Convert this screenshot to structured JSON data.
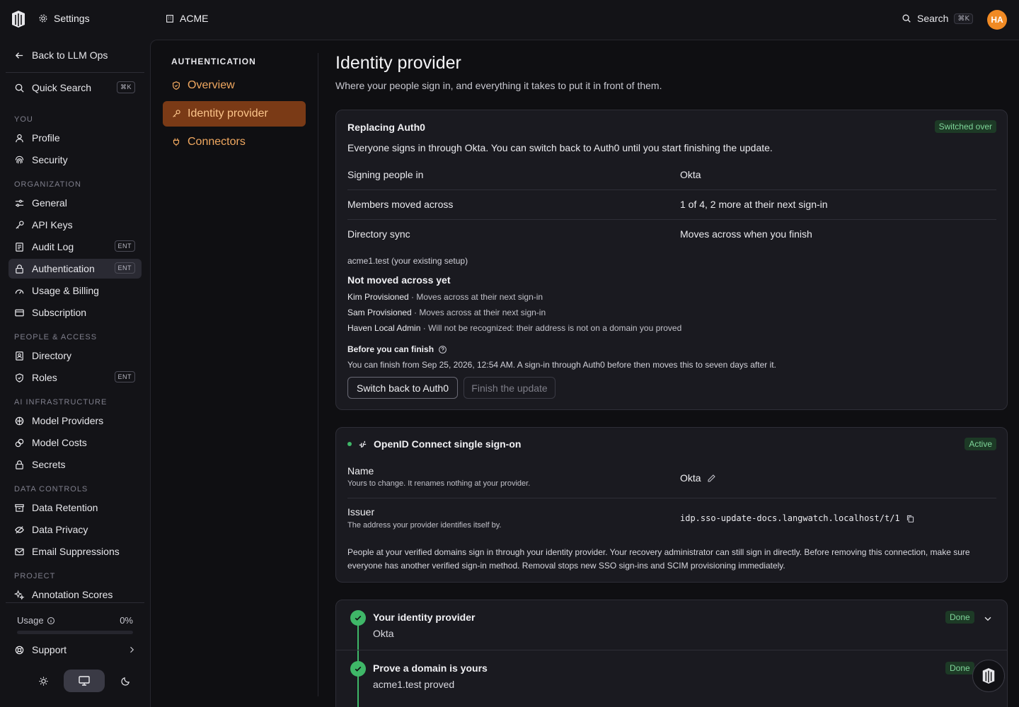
{
  "topbar": {
    "settings_label": "Settings",
    "org_label": "ACME",
    "search_label": "Search",
    "search_shortcut": "⌘K",
    "avatar_initials": "HA",
    "avatar_color": "#f08a24"
  },
  "sidebar": {
    "back_label": "Back to LLM Ops",
    "quick_search_label": "Quick Search",
    "quick_search_shortcut": "⌘K",
    "sections": {
      "you": "YOU",
      "organization": "ORGANIZATION",
      "people": "PEOPLE & ACCESS",
      "ai": "AI INFRASTRUCTURE",
      "data": "DATA CONTROLS",
      "project": "PROJECT"
    },
    "items": {
      "profile": "Profile",
      "security": "Security",
      "general": "General",
      "api_keys": "API Keys",
      "audit_log": "Audit Log",
      "authentication": "Authentication",
      "usage_billing": "Usage & Billing",
      "subscription": "Subscription",
      "directory": "Directory",
      "roles": "Roles",
      "model_providers": "Model Providers",
      "model_costs": "Model Costs",
      "secrets": "Secrets",
      "data_retention": "Data Retention",
      "data_privacy": "Data Privacy",
      "email_suppressions": "Email Suppressions",
      "annotation_scores": "Annotation Scores"
    },
    "ent_badge": "ENT",
    "usage_label": "Usage",
    "usage_value": "0%",
    "usage_fraction": 0,
    "support_label": "Support"
  },
  "subnav": {
    "title": "AUTHENTICATION",
    "overview": "Overview",
    "identity_provider": "Identity provider",
    "connectors": "Connectors"
  },
  "page": {
    "title": "Identity provider",
    "subtitle": "Where your people sign in, and everything it takes to put it in front of them."
  },
  "replacing_card": {
    "title": "Replacing Auth0",
    "badge": "Switched over",
    "description": "Everyone signs in through Okta. You can switch back to Auth0 until you start finishing the update.",
    "rows": [
      {
        "key": "Signing people in",
        "value": "Okta"
      },
      {
        "key": "Members moved across",
        "value": "1 of 4, 2 more at their next sign-in"
      },
      {
        "key": "Directory sync",
        "value": "Moves across when you finish"
      }
    ],
    "existing_setup": "acme1.test (your existing setup)",
    "not_moved_title": "Not moved across yet",
    "not_moved": [
      {
        "name": "Kim Provisioned",
        "note": " · Moves across at their next sign-in"
      },
      {
        "name": "Sam Provisioned",
        "note": " · Moves across at their next sign-in"
      },
      {
        "name": "Haven Local Admin",
        "note": " · Will not be recognized: their address is not on a domain you proved"
      }
    ],
    "before_finish_title": "Before you can finish",
    "before_finish_text": "You can finish from Sep 25, 2026, 12:54 AM. A sign-in through Auth0 before then moves this to seven days after it.",
    "switch_back_label": "Switch back to Auth0",
    "finish_label": "Finish the update"
  },
  "oidc_card": {
    "title": "OpenID Connect single sign-on",
    "badge": "Active",
    "name_label": "Name",
    "name_help": "Yours to change. It renames nothing at your provider.",
    "name_value": "Okta",
    "issuer_label": "Issuer",
    "issuer_help": "The address your provider identifies itself by.",
    "issuer_value": "idp.sso-update-docs.langwatch.localhost/t/1",
    "notice": "People at your verified domains sign in through your identity provider. Your recovery administrator can still sign in directly. Before removing this connection, make sure everyone has another verified sign-in method. Removal stops new SSO sign-ins and SCIM provisioning immediately."
  },
  "steps": [
    {
      "title": "Your identity provider",
      "detail": "Okta",
      "status": "Done"
    },
    {
      "title": "Prove a domain is yours",
      "detail": "acme1.test proved",
      "status": "Done"
    }
  ],
  "colors": {
    "accent": "#f0a860",
    "accent_bg": "#7a3a16",
    "success": "#3fb768",
    "badge_bg": "#1d3a26"
  }
}
